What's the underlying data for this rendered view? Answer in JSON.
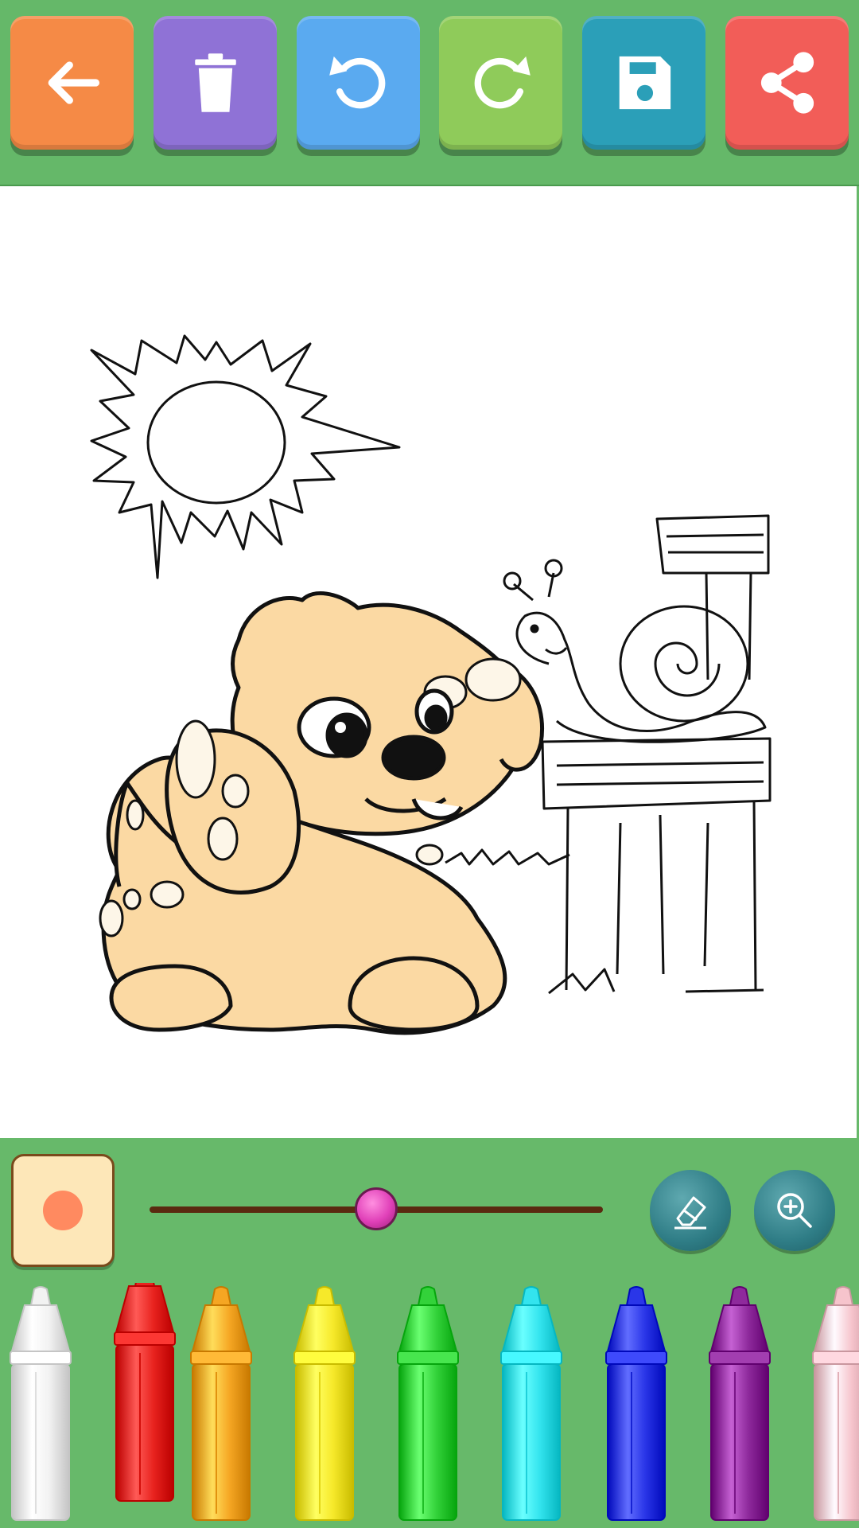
{
  "toolbar": {
    "buttons": [
      {
        "name": "back-button",
        "icon": "arrow-left-icon",
        "color": "#f58a46"
      },
      {
        "name": "clear-button",
        "icon": "trash-icon",
        "color": "#8f72d6"
      },
      {
        "name": "undo-button",
        "icon": "undo-icon",
        "color": "#5aaaf0"
      },
      {
        "name": "redo-button",
        "icon": "redo-icon",
        "color": "#8fcb5a"
      },
      {
        "name": "save-button",
        "icon": "floppy-disk-icon",
        "color": "#2b9fb8"
      },
      {
        "name": "share-button",
        "icon": "share-icon",
        "color": "#f25d58"
      }
    ]
  },
  "controls": {
    "brush_color": "#ff8a60",
    "brush_size_fraction": 0.5,
    "eraser_icon": "eraser-icon",
    "zoom_icon": "zoom-in-icon"
  },
  "palette": {
    "crayons": [
      {
        "color": "#f2f2f2",
        "selected": false
      },
      {
        "color": "#e8231f",
        "selected": true
      },
      {
        "color": "#f5a623",
        "selected": false
      },
      {
        "color": "#f6e92a",
        "selected": false
      },
      {
        "color": "#33d23a",
        "selected": false
      },
      {
        "color": "#33e4ee",
        "selected": false
      },
      {
        "color": "#2a36e8",
        "selected": false
      },
      {
        "color": "#8e2a9c",
        "selected": false
      },
      {
        "color": "#f6c4cc",
        "selected": false
      }
    ]
  }
}
